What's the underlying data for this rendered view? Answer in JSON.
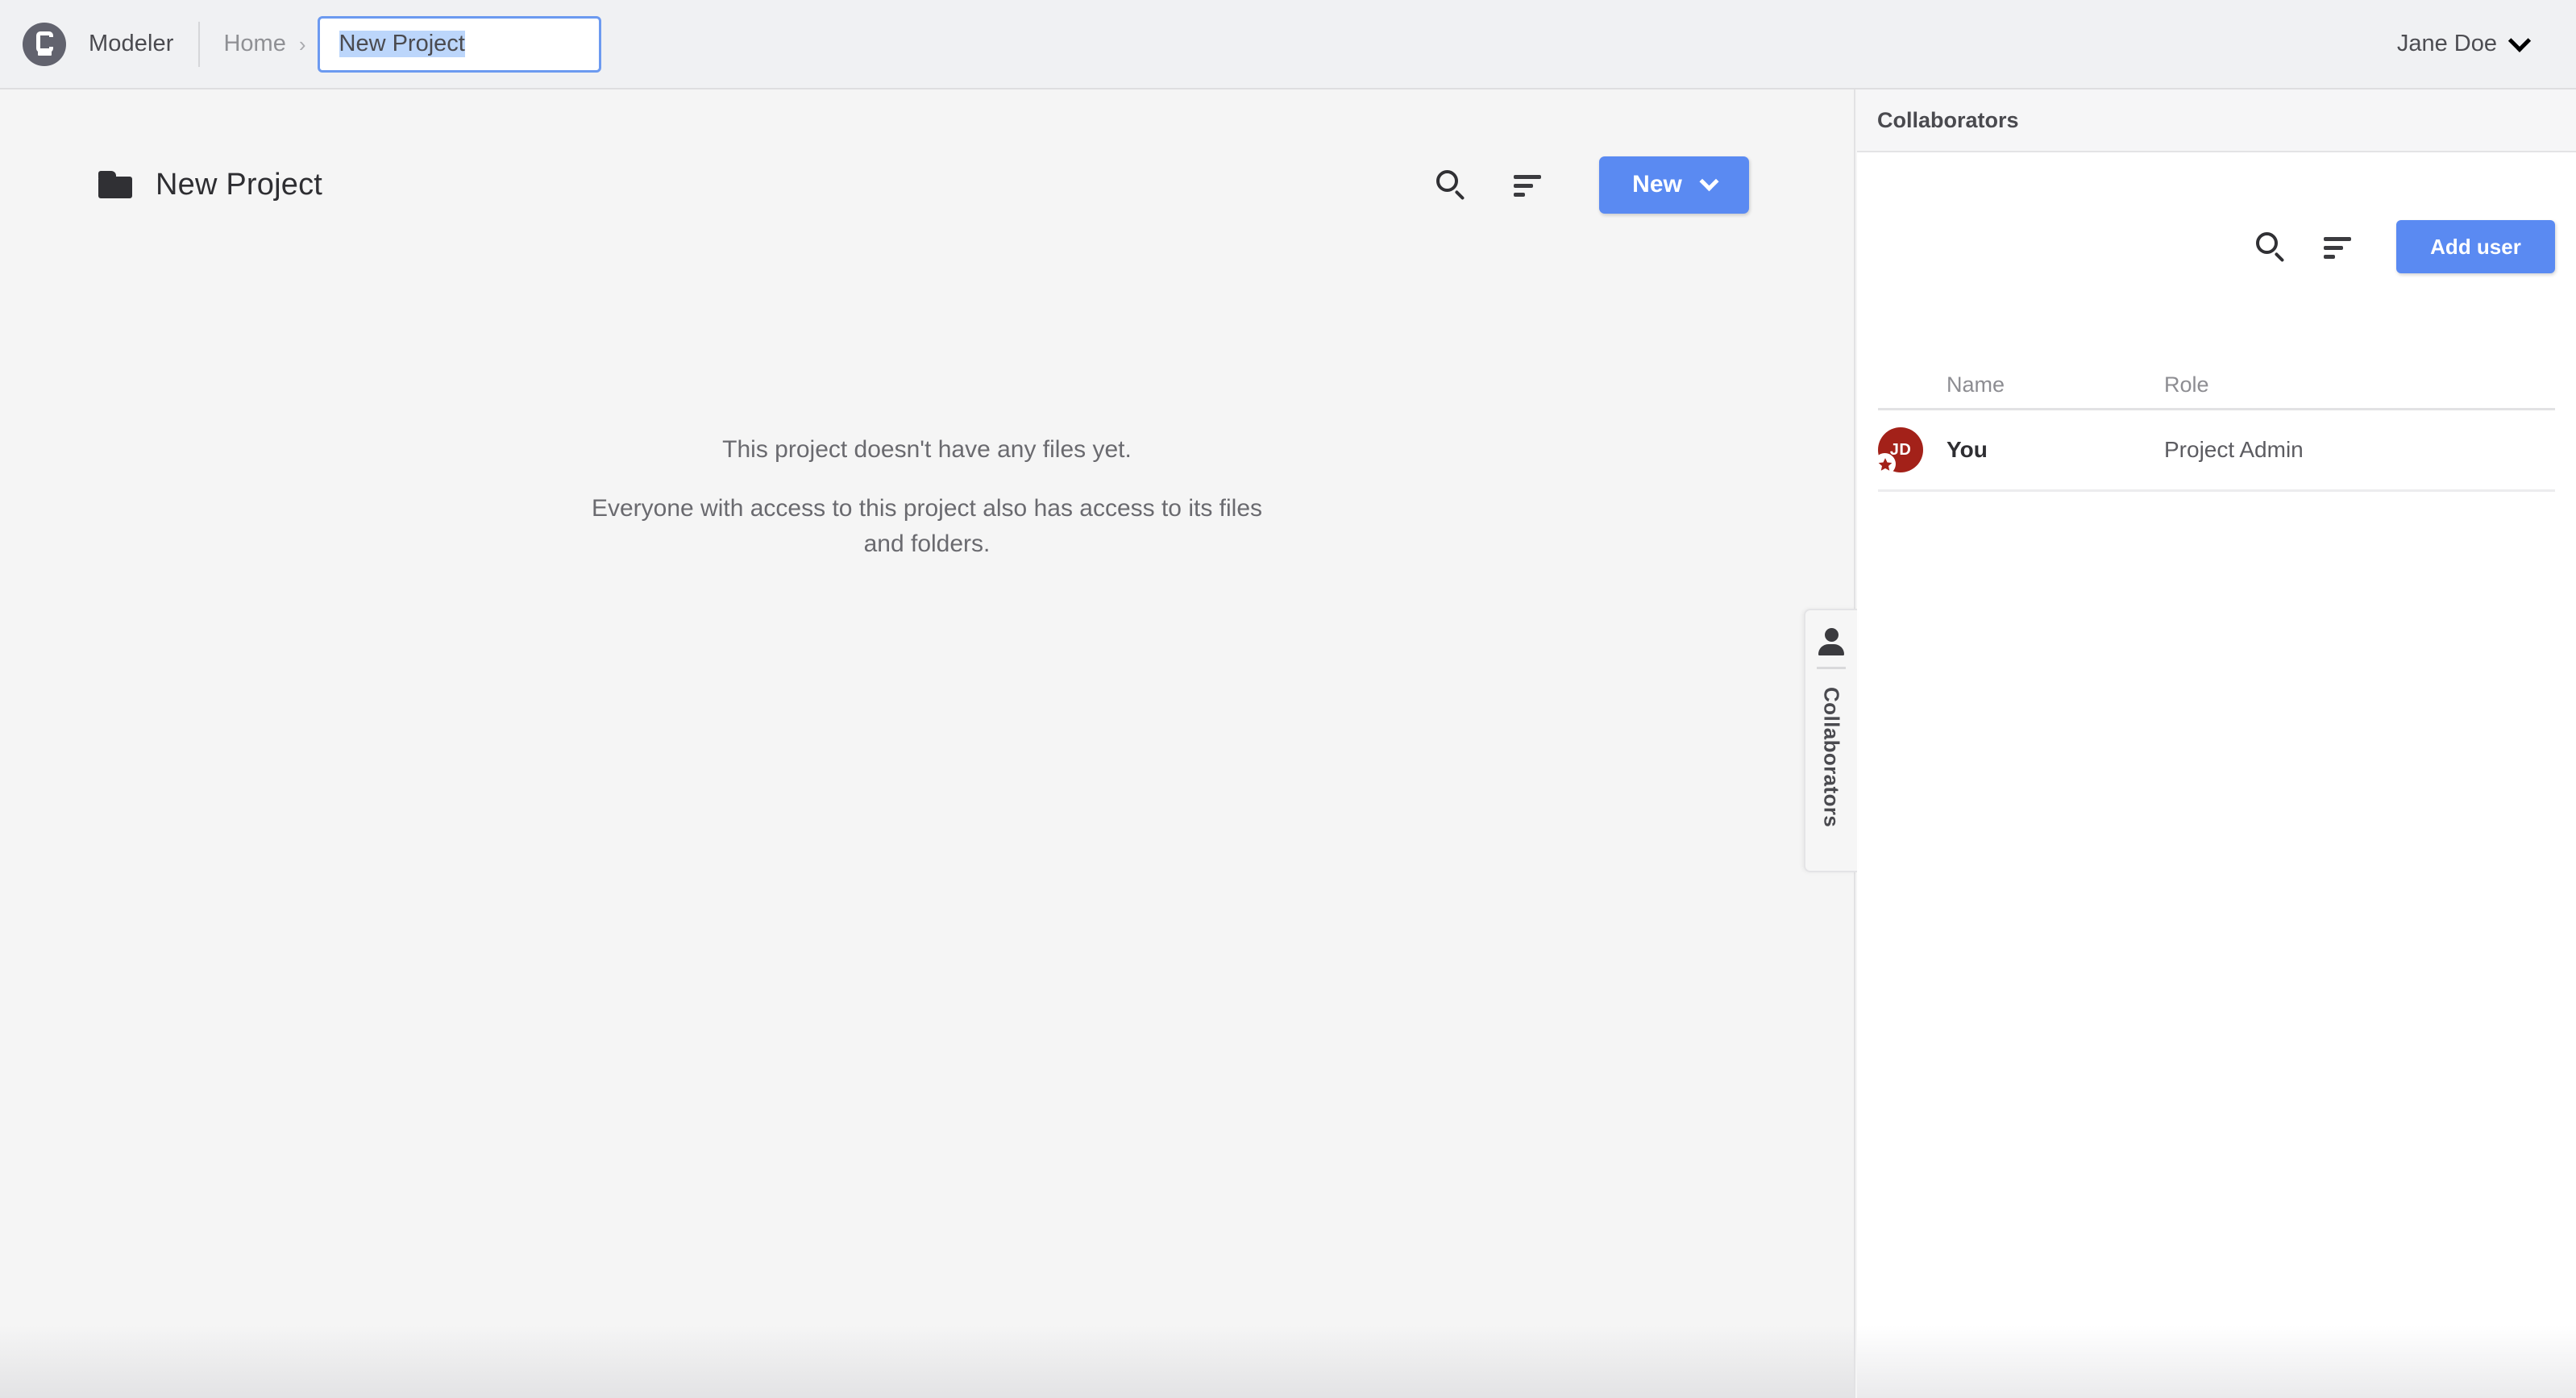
{
  "navbar": {
    "logo_icon": "camunda-logo-icon",
    "brand": "Modeler",
    "breadcrumb": {
      "home": "Home",
      "separator": "›",
      "project_input_value": "New Project",
      "project_input_placeholder": "Project name"
    },
    "user": {
      "name": "Jane Doe",
      "chevron_icon": "chevron-down-icon"
    }
  },
  "main": {
    "folder_icon": "folder-icon",
    "project_title": "New Project",
    "toolbar": {
      "search_icon": "search-icon",
      "sort_icon": "sort-icon",
      "new_label": "New",
      "new_chevron_icon": "chevron-down-icon"
    },
    "empty_state": {
      "line1": "This project doesn't have any files yet.",
      "line2": "Everyone with access to this project also has access to its files and folders."
    }
  },
  "collab_tab": {
    "icon": "person-icon",
    "label": "Collaborators"
  },
  "right_panel": {
    "title": "Collaborators",
    "toolbar": {
      "search_icon": "search-icon",
      "sort_icon": "sort-icon",
      "add_user_label": "Add user"
    },
    "table": {
      "columns": [
        "Name",
        "Role"
      ],
      "rows": [
        {
          "avatar_initials": "JD",
          "avatar_color": "#a32119",
          "badge_icon": "star-badge-icon",
          "name": "You",
          "role": "Project Admin"
        }
      ]
    }
  },
  "colors": {
    "accent_blue": "#5a8af2",
    "navbar_bg": "#f0f1f3",
    "main_bg": "#f5f5f5",
    "panel_bg": "#ffffff",
    "avatar_red": "#a32119",
    "selection_blue": "#bcd6fb"
  }
}
